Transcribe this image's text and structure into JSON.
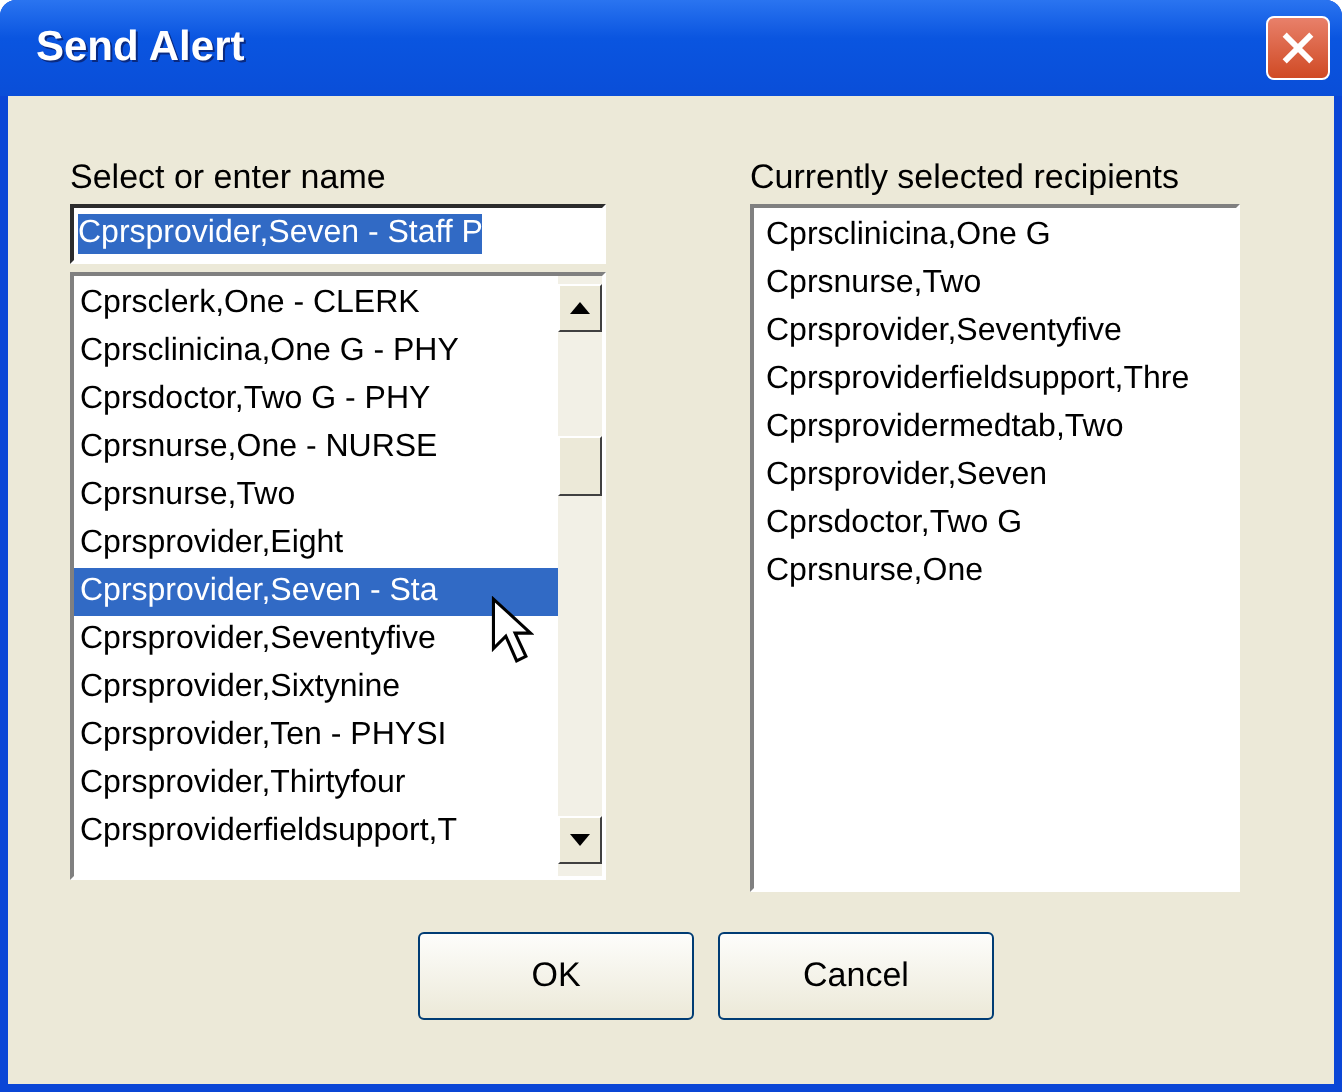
{
  "window": {
    "title": "Send Alert"
  },
  "name_picker": {
    "label": "Select or enter name",
    "field": {
      "value": "Cprsprovider,Seven - Staff P",
      "text_selected": true
    },
    "items": [
      {
        "label": "Cprsclerk,One - CLERK",
        "selected": false
      },
      {
        "label": "Cprsclinicina,One G - PHY",
        "selected": false
      },
      {
        "label": "Cprsdoctor,Two G - PHY",
        "selected": false
      },
      {
        "label": "Cprsnurse,One - NURSE",
        "selected": false
      },
      {
        "label": "Cprsnurse,Two",
        "selected": false
      },
      {
        "label": "Cprsprovider,Eight",
        "selected": false
      },
      {
        "label": "Cprsprovider,Seven - Sta",
        "selected": true
      },
      {
        "label": "Cprsprovider,Seventyfive",
        "selected": false
      },
      {
        "label": "Cprsprovider,Sixtynine",
        "selected": false
      },
      {
        "label": "Cprsprovider,Ten - PHYSI",
        "selected": false
      },
      {
        "label": "Cprsprovider,Thirtyfour",
        "selected": false
      },
      {
        "label": "Cprsproviderfieldsupport,T",
        "selected": false
      }
    ]
  },
  "recipients": {
    "label": "Currently selected recipients",
    "items": [
      "Cprsclinicina,One G",
      "Cprsnurse,Two",
      "Cprsprovider,Seventyfive",
      "Cprsproviderfieldsupport,Thre",
      "Cprsprovidermedtab,Two",
      "Cprsprovider,Seven",
      "Cprsdoctor,Two G",
      "Cprsnurse,One"
    ]
  },
  "buttons": [
    "OK",
    "Cancel"
  ]
}
